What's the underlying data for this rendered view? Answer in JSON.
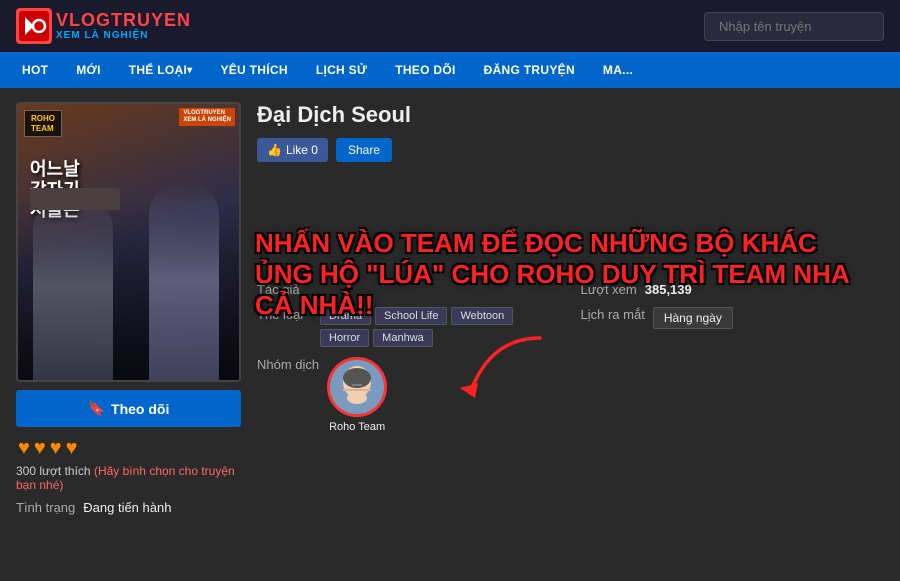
{
  "logo": {
    "main": "VLOGTRUYEN",
    "sub": "XEM LÀ NGHIỆN",
    "icon": "V"
  },
  "search": {
    "placeholder": "Nhập tên truyện"
  },
  "nav": {
    "items": [
      {
        "label": "HOT",
        "has_arrow": false
      },
      {
        "label": "MỚI",
        "has_arrow": false
      },
      {
        "label": "THỂ LOẠI",
        "has_arrow": true
      },
      {
        "label": "YÊU THÍCH",
        "has_arrow": false
      },
      {
        "label": "LỊCH SỬ",
        "has_arrow": false
      },
      {
        "label": "THEO DÕI",
        "has_arrow": false
      },
      {
        "label": "ĐĂNG TRUYỆN",
        "has_arrow": false
      },
      {
        "label": "MA...",
        "has_arrow": false
      }
    ]
  },
  "manga": {
    "title": "Đại Dịch Seoul",
    "cover_title_ko": "어느날\n갑자기\n서울은",
    "cover_label": "ROHO\nTEAM",
    "cover_badge": "VLOGTRUYEN\nXEM LÀ NGHIỆN",
    "like_count": 0,
    "author_label": "Tác giả",
    "author_value": "",
    "genre_label": "Thể loại",
    "genres": [
      "Drama",
      "School Life",
      "Webtoon",
      "Horror",
      "Manhwa"
    ],
    "group_label": "Nhóm dịch",
    "group_name": "Roho Team",
    "views_label": "Lượt xem",
    "views_count": "385,139",
    "release_label": "Lịch ra mắt",
    "release_value": "Hàng ngày",
    "follow_btn": "Theo dõi",
    "hearts": [
      "♥",
      "♥",
      "♥",
      "♥"
    ],
    "likes_text": "300 lượt thích",
    "likes_hint": "(Hãy bình chọn cho truyện bạn nhé)",
    "status_label": "Tình trạng",
    "status_value": "Đang tiến hành",
    "announcement": "NHẤN VÀO TEAM ĐỂ ĐỌC NHỮNG BỘ KHÁC ỦNG HỘ \"LÚA\" CHO ROHO DUY TRÌ TEAM NHA CẢ NHÀ!!",
    "btn_like_label": "Like 0",
    "btn_share_label": "Share"
  }
}
